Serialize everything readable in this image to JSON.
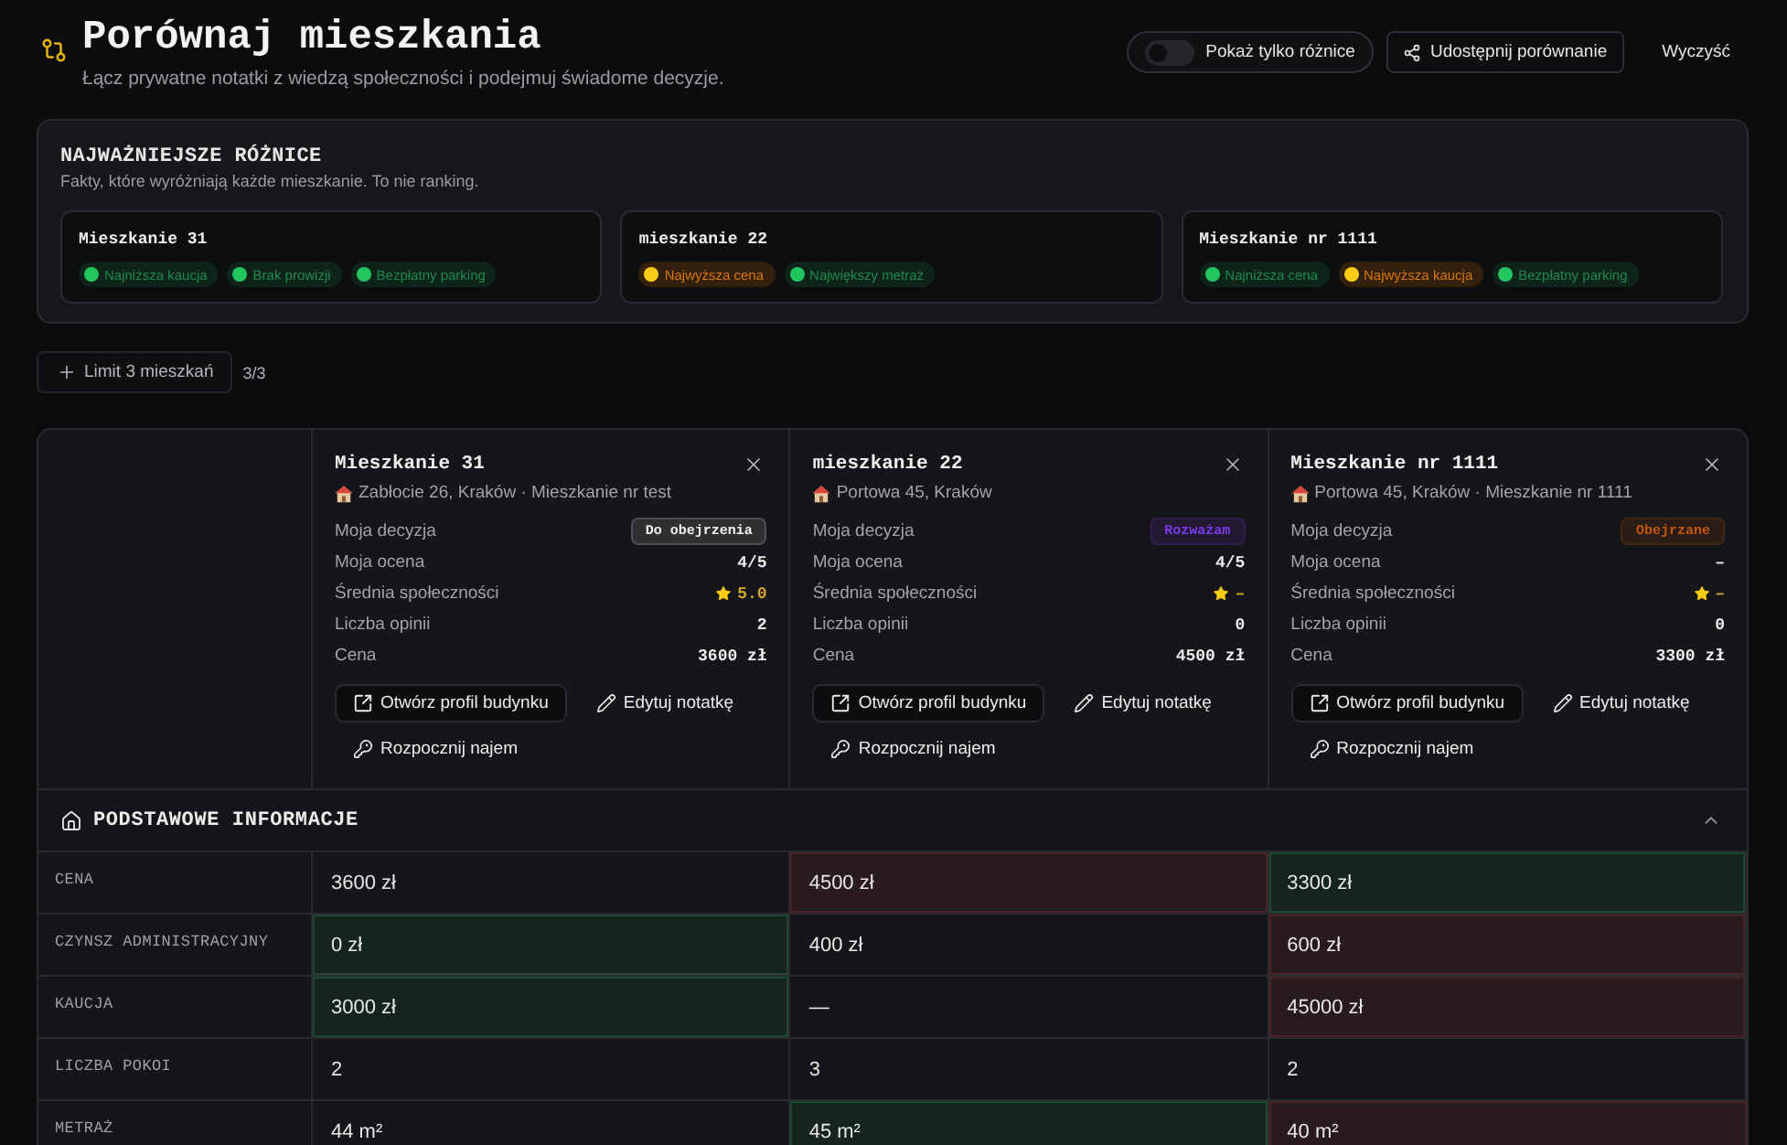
{
  "header": {
    "title": "Porównaj mieszkania",
    "subtitle": "Łącz prywatne notatki z wiedzą społeczności i podejmuj świadome decyzje.",
    "diff_toggle": {
      "label": "Pokaż tylko różnice",
      "on": false
    },
    "share_button": "Udostępnij porównanie",
    "clear_button": "Wyczyść"
  },
  "highlights": {
    "title": "NAJWAŻNIEJSZE RÓŻNICE",
    "subtitle": "Fakty, które wyróżniają każde mieszkanie. To nie ranking.",
    "cards": [
      {
        "name": "Mieszkanie 31",
        "chips": [
          {
            "label": "Najniższa kaucja",
            "kind": "positive"
          },
          {
            "label": "Brak prowizji",
            "kind": "positive"
          },
          {
            "label": "Bezpłatny parking",
            "kind": "positive"
          }
        ]
      },
      {
        "name": "mieszkanie 22",
        "chips": [
          {
            "label": "Najwyższa cena",
            "kind": "warning"
          },
          {
            "label": "Największy metraż",
            "kind": "positive"
          }
        ]
      },
      {
        "name": "Mieszkanie nr 1111",
        "chips": [
          {
            "label": "Najniższa cena",
            "kind": "positive"
          },
          {
            "label": "Najwyższa kaucja",
            "kind": "warning"
          },
          {
            "label": "Bezpłatny parking",
            "kind": "positive"
          }
        ]
      }
    ]
  },
  "limit": {
    "button": "Limit 3 mieszkań",
    "count": "3/3"
  },
  "apartments": [
    {
      "name": "Mieszkanie 31",
      "address": "Zabłocie 26, Kraków · Mieszkanie nr test",
      "details": [
        {
          "label": "Moja decyzja",
          "value": "Do obejrzenia",
          "kind": "badge",
          "color": "#f0f0f0"
        },
        {
          "label": "Moja ocena",
          "value": "4/5",
          "kind": "text"
        },
        {
          "label": "Średnia społeczności",
          "value": "5.0",
          "kind": "rating"
        },
        {
          "label": "Liczba opinii",
          "value": "2",
          "kind": "text"
        },
        {
          "label": "Cena",
          "value": "3600 zł",
          "kind": "text"
        }
      ],
      "actions": [
        {
          "label": "Otwórz profil budynku",
          "kind": "open"
        },
        {
          "label": "Edytuj notatkę",
          "kind": "edit"
        },
        {
          "label": "Rozpocznij najem",
          "kind": "rent"
        }
      ]
    },
    {
      "name": "mieszkanie 22",
      "address": "Portowa 45, Kraków",
      "details": [
        {
          "label": "Moja decyzja",
          "value": "Rozważam",
          "kind": "badge",
          "color": "#7c3aed"
        },
        {
          "label": "Moja ocena",
          "value": "4/5",
          "kind": "text"
        },
        {
          "label": "Średnia społeczności",
          "value": "–",
          "kind": "rating"
        },
        {
          "label": "Liczba opinii",
          "value": "0",
          "kind": "text"
        },
        {
          "label": "Cena",
          "value": "4500 zł",
          "kind": "text"
        }
      ],
      "actions": [
        {
          "label": "Otwórz profil budynku",
          "kind": "open"
        },
        {
          "label": "Edytuj notatkę",
          "kind": "edit"
        },
        {
          "label": "Rozpocznij najem",
          "kind": "rent"
        }
      ]
    },
    {
      "name": "Mieszkanie nr 1111",
      "address": "Portowa 45, Kraków · Mieszkanie nr 1111",
      "details": [
        {
          "label": "Moja decyzja",
          "value": "Obejrzane",
          "kind": "badge",
          "color": "#c2560c"
        },
        {
          "label": "Moja ocena",
          "value": "–",
          "kind": "text"
        },
        {
          "label": "Średnia społeczności",
          "value": "–",
          "kind": "rating"
        },
        {
          "label": "Liczba opinii",
          "value": "0",
          "kind": "text"
        },
        {
          "label": "Cena",
          "value": "3300 zł",
          "kind": "text"
        }
      ],
      "actions": [
        {
          "label": "Otwórz profil budynku",
          "kind": "open"
        },
        {
          "label": "Edytuj notatkę",
          "kind": "edit"
        },
        {
          "label": "Rozpocznij najem",
          "kind": "rent"
        }
      ]
    }
  ],
  "sections": [
    {
      "title": "PODSTAWOWE INFORMACJE",
      "expanded": true,
      "rows": [
        {
          "label": "CENA",
          "cells": [
            {
              "value": "3600 zł",
              "kind": "plain"
            },
            {
              "value": "4500 zł",
              "kind": "worse"
            },
            {
              "value": "3300 zł",
              "kind": "better"
            }
          ]
        },
        {
          "label": "CZYNSZ ADMINISTRACYJNY",
          "cells": [
            {
              "value": "0 zł",
              "kind": "better"
            },
            {
              "value": "400 zł",
              "kind": "plain"
            },
            {
              "value": "600 zł",
              "kind": "worse"
            }
          ]
        },
        {
          "label": "KAUCJA",
          "cells": [
            {
              "value": "3000 zł",
              "kind": "better"
            },
            {
              "value": "—",
              "kind": "plain"
            },
            {
              "value": "45000 zł",
              "kind": "worse"
            }
          ]
        },
        {
          "label": "LICZBA POKOI",
          "cells": [
            {
              "value": "2",
              "kind": "plain"
            },
            {
              "value": "3",
              "kind": "plain"
            },
            {
              "value": "2",
              "kind": "plain"
            }
          ]
        },
        {
          "label": "METRAŻ",
          "cells": [
            {
              "value": "44 m²",
              "kind": "plain"
            },
            {
              "value": "45 m²",
              "kind": "better"
            },
            {
              "value": "40 m²",
              "kind": "worse"
            }
          ]
        }
      ]
    }
  ]
}
